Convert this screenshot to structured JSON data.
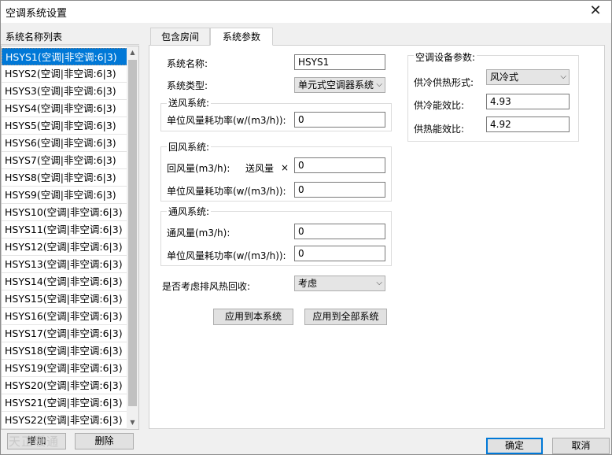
{
  "window": {
    "title": "空调系统设置",
    "close_glyph": "✕"
  },
  "sidebar": {
    "header": "系统名称列表",
    "items": [
      "HSYS1(空调|非空调:6|3)",
      "HSYS2(空调|非空调:6|3)",
      "HSYS3(空调|非空调:6|3)",
      "HSYS4(空调|非空调:6|3)",
      "HSYS5(空调|非空调:6|3)",
      "HSYS6(空调|非空调:6|3)",
      "HSYS7(空调|非空调:6|3)",
      "HSYS8(空调|非空调:6|3)",
      "HSYS9(空调|非空调:6|3)",
      "HSYS10(空调|非空调:6|3)",
      "HSYS11(空调|非空调:6|3)",
      "HSYS12(空调|非空调:6|3)",
      "HSYS13(空调|非空调:6|3)",
      "HSYS14(空调|非空调:6|3)",
      "HSYS15(空调|非空调:6|3)",
      "HSYS16(空调|非空调:6|3)",
      "HSYS17(空调|非空调:6|3)",
      "HSYS18(空调|非空调:6|3)",
      "HSYS19(空调|非空调:6|3)",
      "HSYS20(空调|非空调:6|3)",
      "HSYS21(空调|非空调:6|3)",
      "HSYS22(空调|非空调:6|3)"
    ],
    "selected_index": 0,
    "add_label": "增加",
    "delete_label": "删除"
  },
  "tabs": [
    {
      "label": "包含房间",
      "active": false
    },
    {
      "label": "系统参数",
      "active": true
    }
  ],
  "params": {
    "system_name_label": "系统名称:",
    "system_name_value": "HSYS1",
    "system_type_label": "系统类型:",
    "system_type_value": "单元式空调器系统",
    "supply": {
      "title": "送风系统:",
      "fan_power_label": "单位风量耗功率(w/(m3/h)):",
      "fan_power_value": "0"
    },
    "return": {
      "title": "回风系统:",
      "volume_label": "回风量(m3/h):",
      "supply_ref_label": "送风量",
      "multiply": "×",
      "volume_value": "0",
      "fan_power_label": "单位风量耗功率(w/(m3/h)):",
      "fan_power_value": "0"
    },
    "ventilation": {
      "title": "通风系统:",
      "volume_label": "通风量(m3/h):",
      "volume_value": "0",
      "fan_power_label": "单位风量耗功率(w/(m3/h)):",
      "fan_power_value": "0"
    },
    "heat_recovery_label": "是否考虑排风热回收:",
    "heat_recovery_value": "考虑",
    "apply_this_label": "应用到本系统",
    "apply_all_label": "应用到全部系统"
  },
  "equipment": {
    "title": "空调设备参数:",
    "mode_label": "供冷供热形式:",
    "mode_value": "风冷式",
    "cooling_cop_label": "供冷能效比:",
    "cooling_cop_value": "4.93",
    "heating_cop_label": "供热能效比:",
    "heating_cop_value": "4.92"
  },
  "footer": {
    "ok_label": "确定",
    "cancel_label": "取消"
  },
  "watermark": "天正暖通"
}
